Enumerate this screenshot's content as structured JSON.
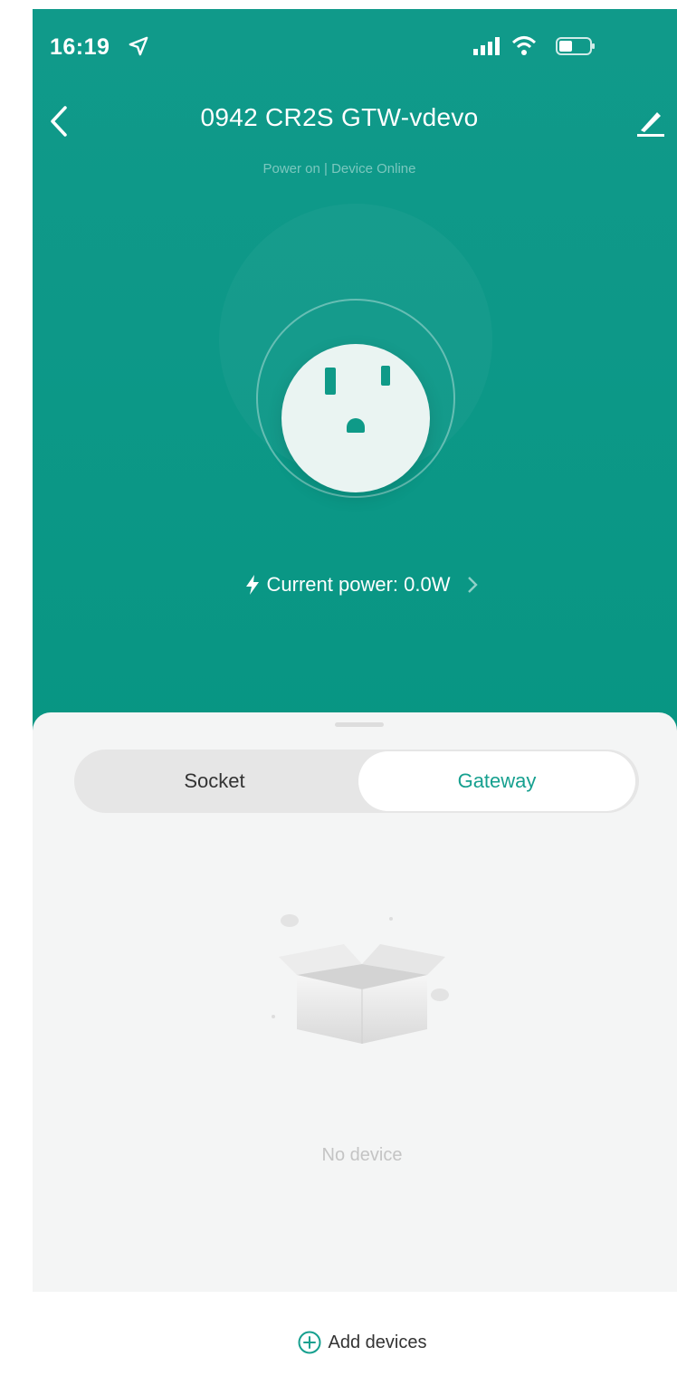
{
  "status_bar": {
    "time": "16:19",
    "icons": [
      "location-arrow-icon",
      "signal-icon",
      "wifi-icon",
      "battery-icon"
    ]
  },
  "header": {
    "title": "0942 CR2S GTW-vdevo",
    "subtitle": "Power on | Device Online",
    "back_icon": "chevron-left-icon",
    "edit_icon": "pencil-icon"
  },
  "device": {
    "icon": "power-socket-icon",
    "power_label": "Current power: 0.0W"
  },
  "tabs": [
    {
      "label": "Socket",
      "selected": false
    },
    {
      "label": "Gateway",
      "selected": true
    }
  ],
  "empty_state": {
    "illustration": "empty-box-icon",
    "text": "No device"
  },
  "add_button": {
    "label": "Add devices",
    "icon": "plus-circle-icon"
  },
  "colors": {
    "brand": "#0d9888",
    "accent": "#16a08f",
    "sheet_bg": "#f4f5f5"
  }
}
